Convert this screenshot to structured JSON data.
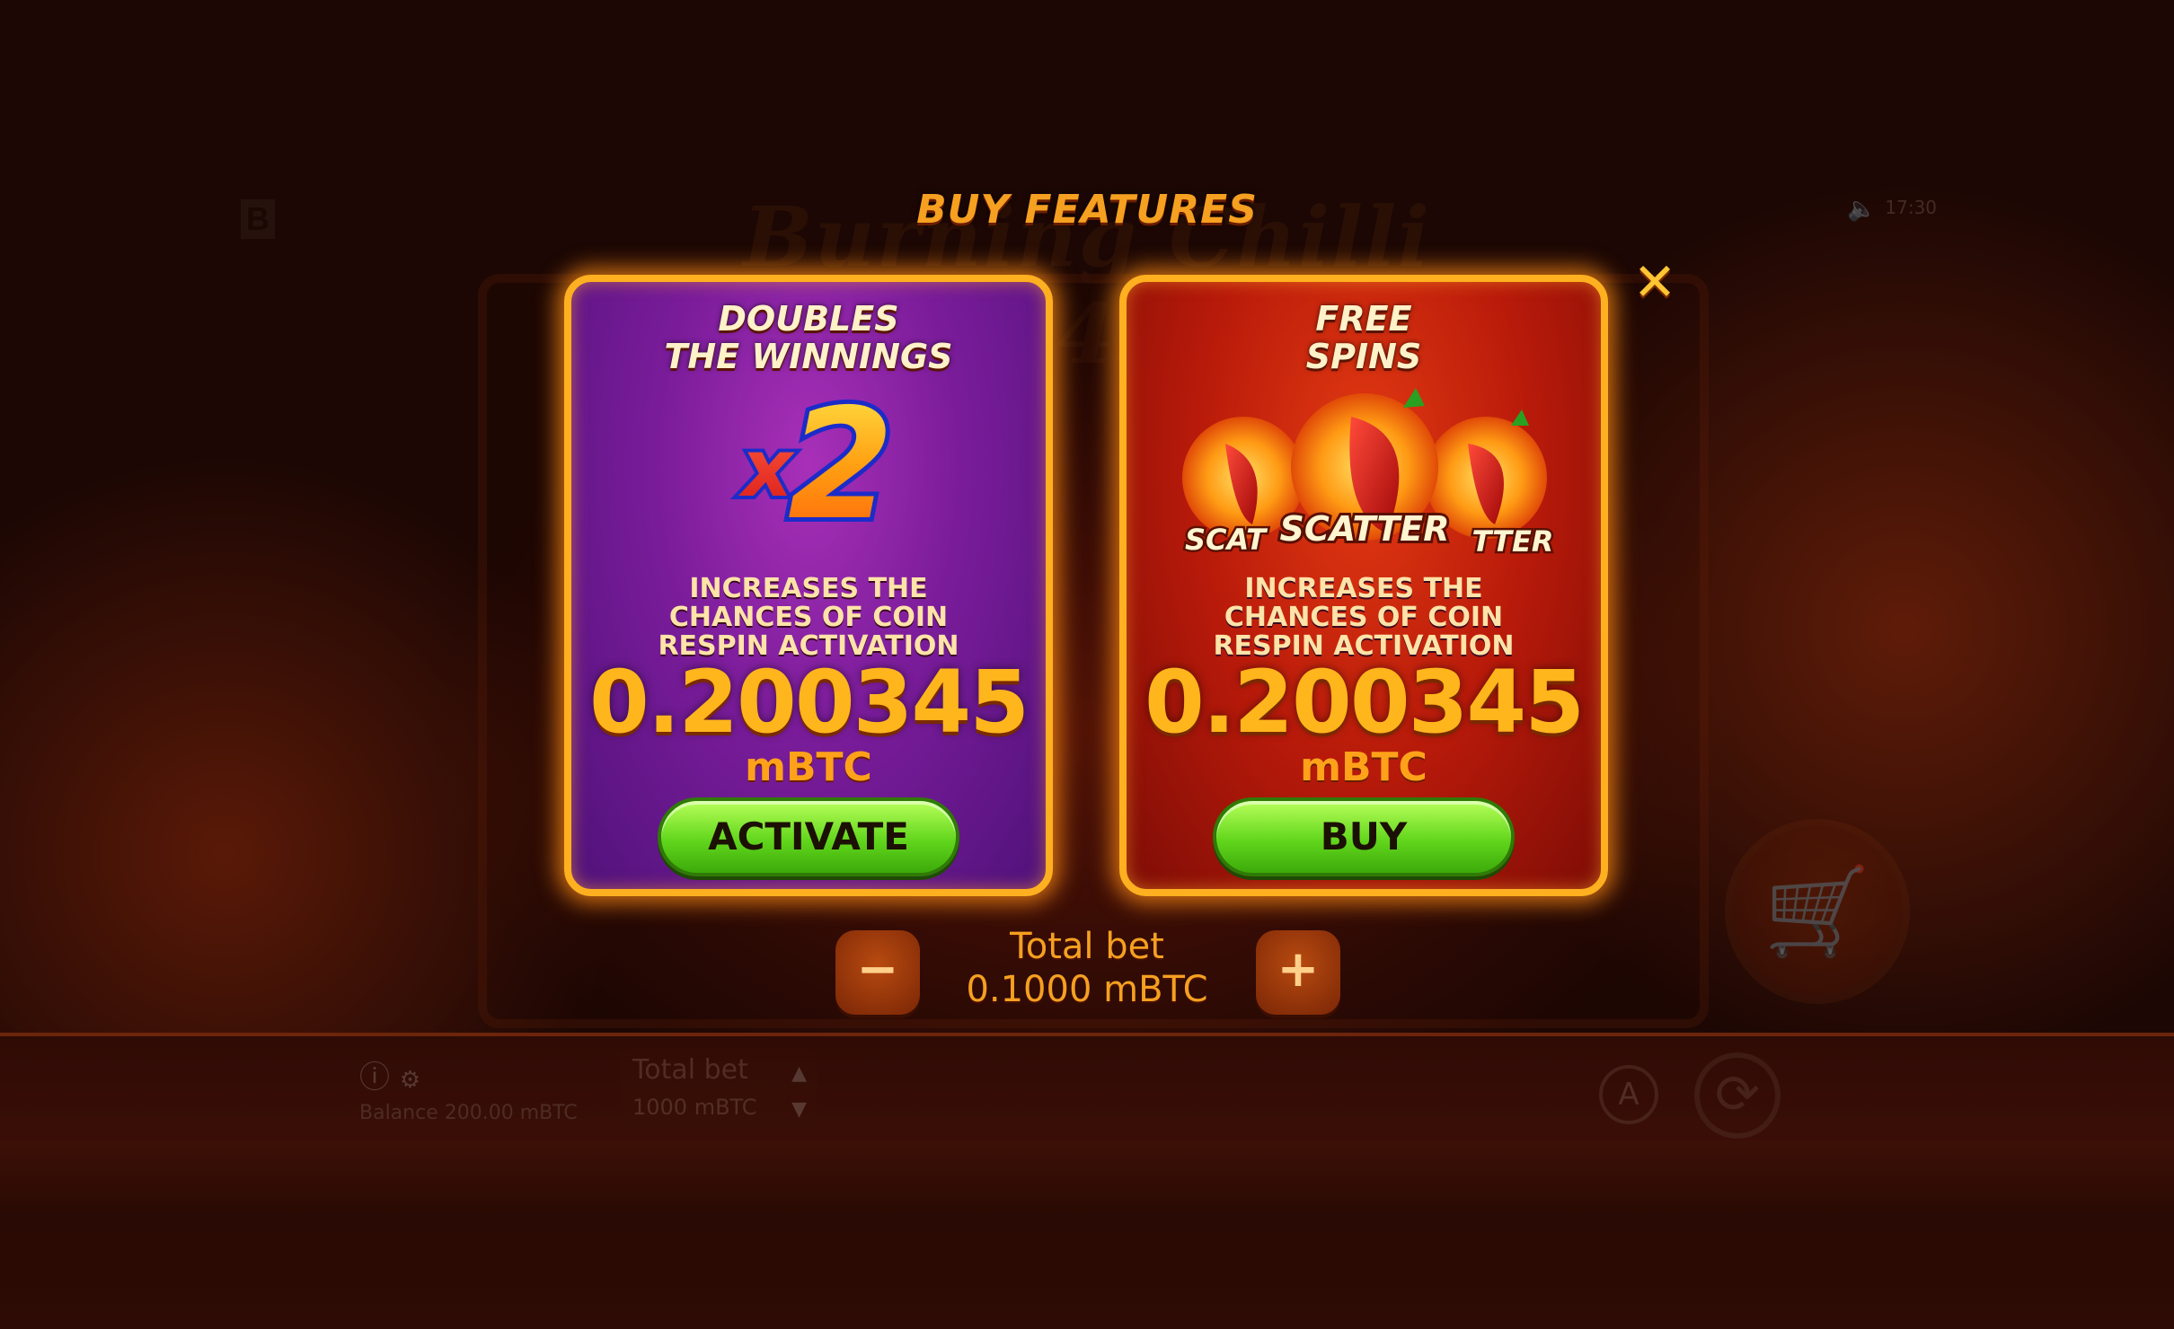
{
  "game": {
    "logo_letter": "B",
    "title": "Burning Chilli 243",
    "time": "17:30",
    "balance": "Balance 200.00 mBTC",
    "total_bet_label": "Total bet",
    "total_bet_value": "1000 mBTC",
    "auto_label": "A"
  },
  "modal": {
    "title": "BUY FEATURES",
    "close_label": "✕",
    "cards": [
      {
        "heading_line1": "DOUBLES",
        "heading_line2": "THE WINNINGS",
        "multiplier_x": "x",
        "multiplier_num": "2",
        "desc_line1": "INCREASES THE",
        "desc_line2": "CHANCES OF COIN",
        "desc_line3": "RESPIN ACTIVATION",
        "price": "0.200345",
        "unit": "mBTC",
        "button": "ACTIVATE"
      },
      {
        "heading_line1": "FREE",
        "heading_line2": "SPINS",
        "scatter_left": "SCAT",
        "scatter_center": "SCATTER",
        "scatter_right": "TTER",
        "desc_line1": "INCREASES THE",
        "desc_line2": "CHANCES OF COIN",
        "desc_line3": "RESPIN ACTIVATION",
        "price": "0.200345",
        "unit": "mBTC",
        "button": "BUY"
      }
    ],
    "total_bet_label": "Total bet",
    "total_bet_value": "0.1000 mBTC",
    "minus_label": "−",
    "plus_label": "+"
  },
  "colors": {
    "accent_orange": "#f5a020",
    "button_green": "#62d61c",
    "card_left_purple": "#7a1c9a",
    "card_right_red": "#b81a0a"
  }
}
